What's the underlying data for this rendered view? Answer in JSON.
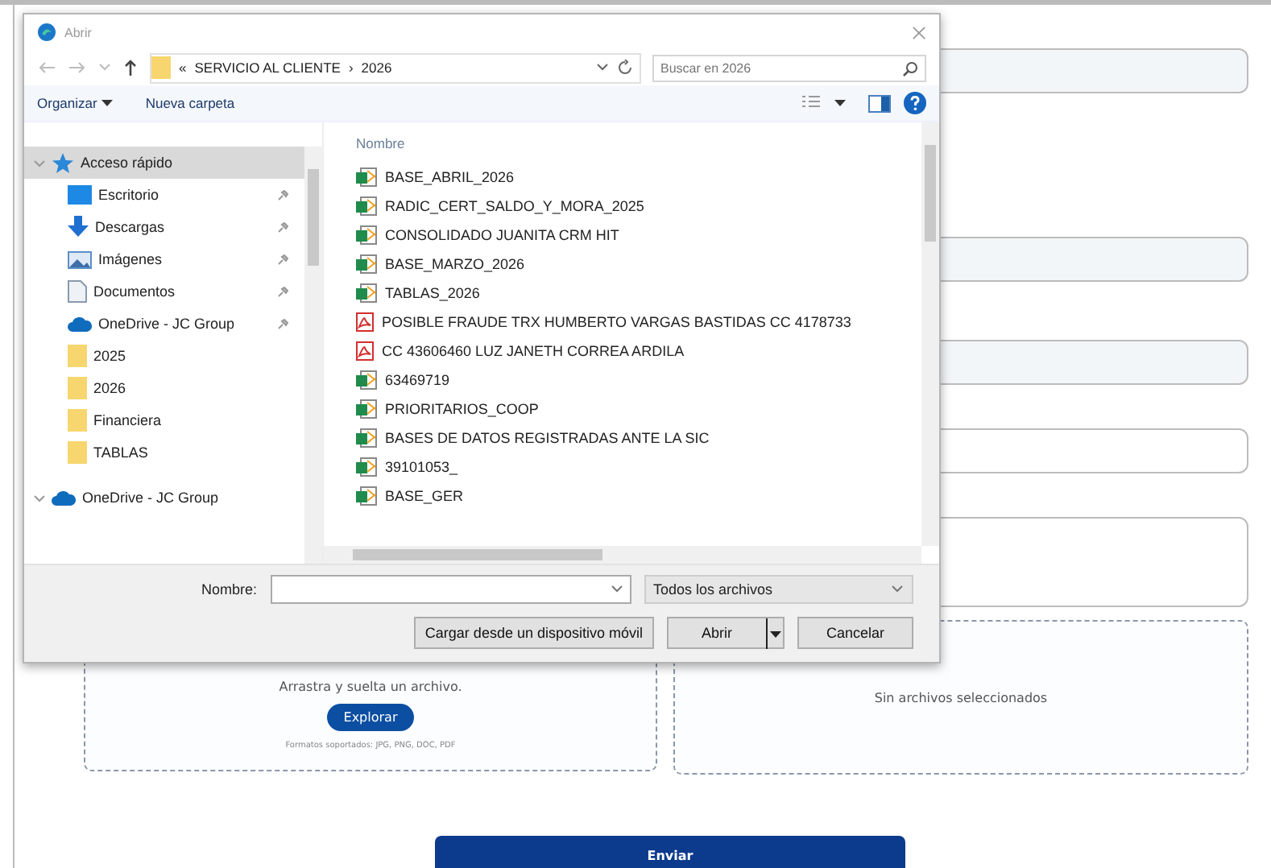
{
  "dialog": {
    "title": "Abrir",
    "breadcrumb": {
      "overflow": "«",
      "separator": "›",
      "path": [
        "SERVICIO AL CLIENTE",
        "2026"
      ]
    },
    "search": {
      "placeholder": "Buscar en 2026"
    },
    "toolbar": {
      "organize": "Organizar",
      "new_folder": "Nueva carpeta"
    },
    "sidebar": [
      {
        "label": "Acceso rápido",
        "kind": "star",
        "selected": true,
        "expanded": true,
        "children": [
          {
            "label": "Escritorio",
            "kind": "desktop",
            "pinned": true,
            "selected": false
          },
          {
            "label": "Descargas",
            "kind": "download",
            "pinned": true,
            "selected": false
          },
          {
            "label": "Imágenes",
            "kind": "pictures",
            "pinned": true,
            "selected": false
          },
          {
            "label": "Documentos",
            "kind": "document",
            "pinned": true,
            "selected": false
          },
          {
            "label": "OneDrive - JC Group",
            "kind": "cloud",
            "pinned": true,
            "selected": false
          },
          {
            "label": "2025",
            "kind": "folder",
            "pinned": false,
            "selected": false
          },
          {
            "label": "2026",
            "kind": "folder",
            "pinned": false,
            "selected": false
          },
          {
            "label": "Financiera",
            "kind": "folder",
            "pinned": false,
            "selected": false
          },
          {
            "label": "TABLAS",
            "kind": "folder",
            "pinned": false,
            "selected": false
          }
        ]
      },
      {
        "label": "OneDrive - JC Group",
        "kind": "cloud",
        "selected": false,
        "expanded": true
      }
    ],
    "column_header": "Nombre",
    "files": [
      {
        "name": "BASE_ABRIL_2026",
        "kind": "spreadsheet"
      },
      {
        "name": "RADIC_CERT_SALDO_Y_MORA_2025",
        "kind": "spreadsheet"
      },
      {
        "name": "CONSOLIDADO JUANITA CRM HIT",
        "kind": "spreadsheet"
      },
      {
        "name": "BASE_MARZO_2026",
        "kind": "spreadsheet"
      },
      {
        "name": "TABLAS_2026",
        "kind": "spreadsheet"
      },
      {
        "name": "POSIBLE FRAUDE TRX HUMBERTO VARGAS BASTIDAS CC 4178733",
        "kind": "pdf"
      },
      {
        "name": "CC 43606460 LUZ JANETH CORREA ARDILA",
        "kind": "pdf"
      },
      {
        "name": "63469719",
        "kind": "spreadsheet"
      },
      {
        "name": "PRIORITARIOS_COOP",
        "kind": "spreadsheet"
      },
      {
        "name": "BASES DE DATOS REGISTRADAS ANTE LA SIC",
        "kind": "spreadsheet"
      },
      {
        "name": "39101053_",
        "kind": "spreadsheet"
      },
      {
        "name": "BASE_GER",
        "kind": "spreadsheet"
      }
    ],
    "filename_label": "Nombre:",
    "filetype": "Todos los archivos",
    "buttons": {
      "mobile": "Cargar desde un dispositivo móvil",
      "open": "Abrir",
      "cancel": "Cancelar"
    }
  },
  "form": {
    "upload": {
      "hint": "Arrastra y suelta un archivo.",
      "browse": "Explorar",
      "formats": "Formatos soportados: JPG, PNG, DOC, PDF"
    },
    "selected_files": "Sin archivos seleccionados",
    "submit": "Enviar"
  }
}
